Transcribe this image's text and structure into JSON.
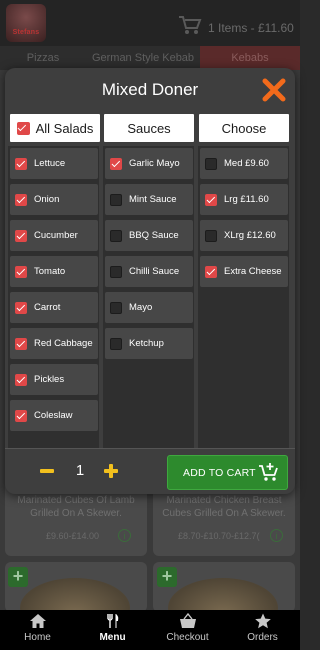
{
  "header": {
    "logo_text": "Stefans",
    "cart_summary": "1 Items - £11.60"
  },
  "category_tabs": [
    {
      "label": "Pizzas"
    },
    {
      "label": "German Style Kebab"
    },
    {
      "label": "Kebabs"
    }
  ],
  "background_items": [
    {
      "description": "Marinated Cubes Of Lamb Grilled On A Skewer.",
      "price": "£9.60-£14.00"
    },
    {
      "description": "Marinated Chicken Breast Cubes Grilled On A Skewer.",
      "price": "£8.70-£10.70-£12.7("
    }
  ],
  "modal": {
    "title": "Mixed Doner",
    "columns": [
      {
        "header": "All Salads",
        "header_checked": true,
        "options": [
          {
            "label": "Lettuce",
            "checked": true
          },
          {
            "label": "Onion",
            "checked": true
          },
          {
            "label": "Cucumber",
            "checked": true
          },
          {
            "label": "Tomato",
            "checked": true
          },
          {
            "label": "Carrot",
            "checked": true
          },
          {
            "label": "Red Cabbage",
            "checked": true
          },
          {
            "label": "Pickles",
            "checked": true
          },
          {
            "label": "Coleslaw",
            "checked": true
          }
        ]
      },
      {
        "header": "Sauces",
        "options": [
          {
            "label": "Garlic Mayo",
            "checked": true
          },
          {
            "label": "Mint Sauce",
            "checked": false
          },
          {
            "label": "BBQ Sauce",
            "checked": false
          },
          {
            "label": "Chilli Sauce",
            "checked": false
          },
          {
            "label": "Mayo",
            "checked": false
          },
          {
            "label": "Ketchup",
            "checked": false
          }
        ]
      },
      {
        "header": "Choose",
        "options": [
          {
            "label": "Med £9.60",
            "checked": false
          },
          {
            "label": "Lrg £11.60",
            "checked": true
          },
          {
            "label": "XLrg £12.60",
            "checked": false
          },
          {
            "label": "Extra Cheese",
            "checked": true
          }
        ]
      }
    ],
    "quantity": "1",
    "add_to_cart_label": "ADD TO CART"
  },
  "bottom_nav": [
    {
      "label": "Home",
      "icon": "home-icon",
      "active": false
    },
    {
      "label": "Menu",
      "icon": "cutlery-icon",
      "active": true
    },
    {
      "label": "Checkout",
      "icon": "basket-icon",
      "active": false
    },
    {
      "label": "Orders",
      "icon": "star-icon",
      "active": false
    }
  ],
  "colors": {
    "accent_red": "#e04848",
    "close_orange": "#f26a1b",
    "qty_yellow": "#f2c01e",
    "cart_green": "#2d8a2d"
  }
}
